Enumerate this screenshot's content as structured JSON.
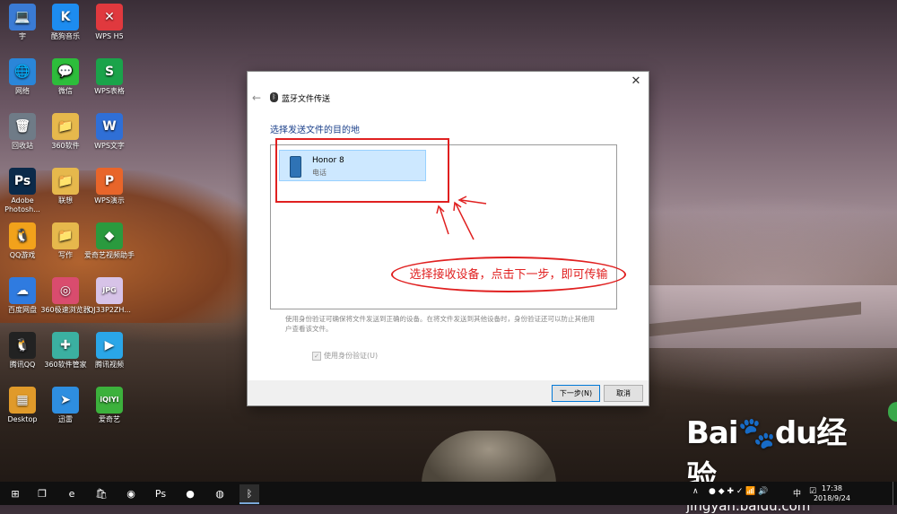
{
  "desktop": {
    "icons": [
      {
        "label": "宇",
        "glyph": "💻",
        "color": "#3a7bd5"
      },
      {
        "label": "酷狗音乐",
        "glyph": "K",
        "color": "#1d8cf0"
      },
      {
        "label": "WPS H5",
        "glyph": "✕",
        "color": "#e0393e"
      },
      {
        "label": "网络",
        "glyph": "🌐",
        "color": "#2a86d9"
      },
      {
        "label": "微信",
        "glyph": "💬",
        "color": "#2dbd3b"
      },
      {
        "label": "WPS表格",
        "glyph": "S",
        "color": "#1aa34a"
      },
      {
        "label": "回收站",
        "glyph": "🗑",
        "color": "#6f7b87"
      },
      {
        "label": "360软件",
        "glyph": "📁",
        "color": "#e6b84c"
      },
      {
        "label": "WPS文字",
        "glyph": "W",
        "color": "#2f6fd6"
      },
      {
        "label": "Adobe Photosh...",
        "glyph": "Ps",
        "color": "#0b2a4a"
      },
      {
        "label": "联想",
        "glyph": "📁",
        "color": "#e6b84c"
      },
      {
        "label": "WPS演示",
        "glyph": "P",
        "color": "#e8652a"
      },
      {
        "label": "QQ游戏",
        "glyph": "🐧",
        "color": "#f2a21b"
      },
      {
        "label": "写作",
        "glyph": "📁",
        "color": "#e6b84c"
      },
      {
        "label": "爱奇艺视频助手",
        "glyph": "◆",
        "color": "#2a9a3e"
      },
      {
        "label": "百度网盘",
        "glyph": "☁",
        "color": "#2f7be0"
      },
      {
        "label": "360极速浏览器",
        "glyph": "◎",
        "color": "#d94c6e"
      },
      {
        "label": "QJ33P2ZH...",
        "glyph": "JPG",
        "color": "#d7c3e8"
      },
      {
        "label": "腾讯QQ",
        "glyph": "🐧",
        "color": "#222222"
      },
      {
        "label": "360软件管家",
        "glyph": "✚",
        "color": "#3bb0a1"
      },
      {
        "label": "腾讯视频",
        "glyph": "▶",
        "color": "#2aa6e8"
      },
      {
        "label": "Desktop",
        "glyph": "▦",
        "color": "#e09a2a"
      },
      {
        "label": "迅雷",
        "glyph": "➤",
        "color": "#2e8ee0"
      },
      {
        "label": "爱奇艺",
        "glyph": "iQIYI",
        "color": "#3cb13c"
      }
    ]
  },
  "dialog": {
    "title": "蓝牙文件传送",
    "back_glyph": "←",
    "close_glyph": "✕",
    "bt_glyph": "ᛒ",
    "heading": "选择发送文件的目的地",
    "device": {
      "name": "Honor 8",
      "type": "电话"
    },
    "description": "使用身份验证可确保将文件发送到正确的设备。在将文件发送到其他设备时，身份验证还可以防止其他用户查看该文件。",
    "auth_checkbox": {
      "label": "使用身份验证(U)",
      "checked": true,
      "check_glyph": "✓"
    },
    "next_button": "下一步(N)",
    "cancel_button": "取消"
  },
  "annotation": {
    "text": "选择接收设备，点击下一步，即可传输",
    "color": "#e02020"
  },
  "watermark": {
    "logo": "Bai🐾du经验",
    "url": "jingyan.baidu.com"
  },
  "taskbar": {
    "start_glyph": "⊞",
    "items": [
      {
        "name": "task-view",
        "glyph": "❐"
      },
      {
        "name": "edge",
        "glyph": "e"
      },
      {
        "name": "store",
        "glyph": "🛍"
      },
      {
        "name": "browser",
        "glyph": "◉"
      },
      {
        "name": "photoshop",
        "glyph": "Ps"
      },
      {
        "name": "color-app",
        "glyph": "●"
      },
      {
        "name": "game-app",
        "glyph": "◍"
      },
      {
        "name": "bluetooth",
        "glyph": "ᛒ"
      }
    ],
    "tray": {
      "chevron": "∧",
      "ime": "中",
      "time": "17:38",
      "date": "2018/9/24"
    }
  }
}
